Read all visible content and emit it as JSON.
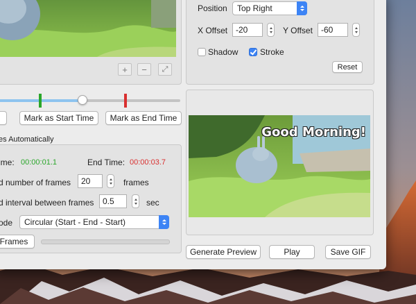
{
  "overlay_settings": {
    "position_label": "Position",
    "position_value": "Top Right",
    "x_offset_label": "X Offset",
    "x_offset_value": "-20",
    "y_offset_label": "Y Offset",
    "y_offset_value": "-60",
    "shadow_label": "Shadow",
    "shadow_checked": false,
    "stroke_label": "Stroke",
    "stroke_checked": true,
    "reset_label": "Reset"
  },
  "video_controls": {
    "zoom_in_glyph": "+",
    "zoom_out_glyph": "−",
    "fit_glyph": "⤢"
  },
  "timeline": {
    "playhead_fraction": 0.46,
    "start_marker_fraction": 0.23,
    "end_marker_fraction": 0.7,
    "mark_start_label": "Mark as Start Time",
    "mark_end_label": "Mark as End Time"
  },
  "frames_section": {
    "title": "es Automatically",
    "start_time_label": "ime:",
    "start_time_value": "00:00:01.1",
    "end_time_label": "End Time:",
    "end_time_value": "00:00:03.7",
    "frames_count_label": "d number of frames",
    "frames_count_value": "20",
    "frames_unit": "frames",
    "interval_label": "d interval between frames",
    "interval_value": "0.5",
    "interval_unit": "sec",
    "mode_label": "ode",
    "mode_value": "Circular (Start - End - Start)",
    "frames_button_label": "Frames"
  },
  "preview": {
    "caption_text": "Good Morning!",
    "generate_label": "Generate Preview",
    "play_label": "Play",
    "save_label": "Save GIF"
  },
  "colors": {
    "start_time": "#2aa62a",
    "end_time": "#d93030",
    "accent": "#3d84f5",
    "slider_fill": "#8ec4ef"
  }
}
